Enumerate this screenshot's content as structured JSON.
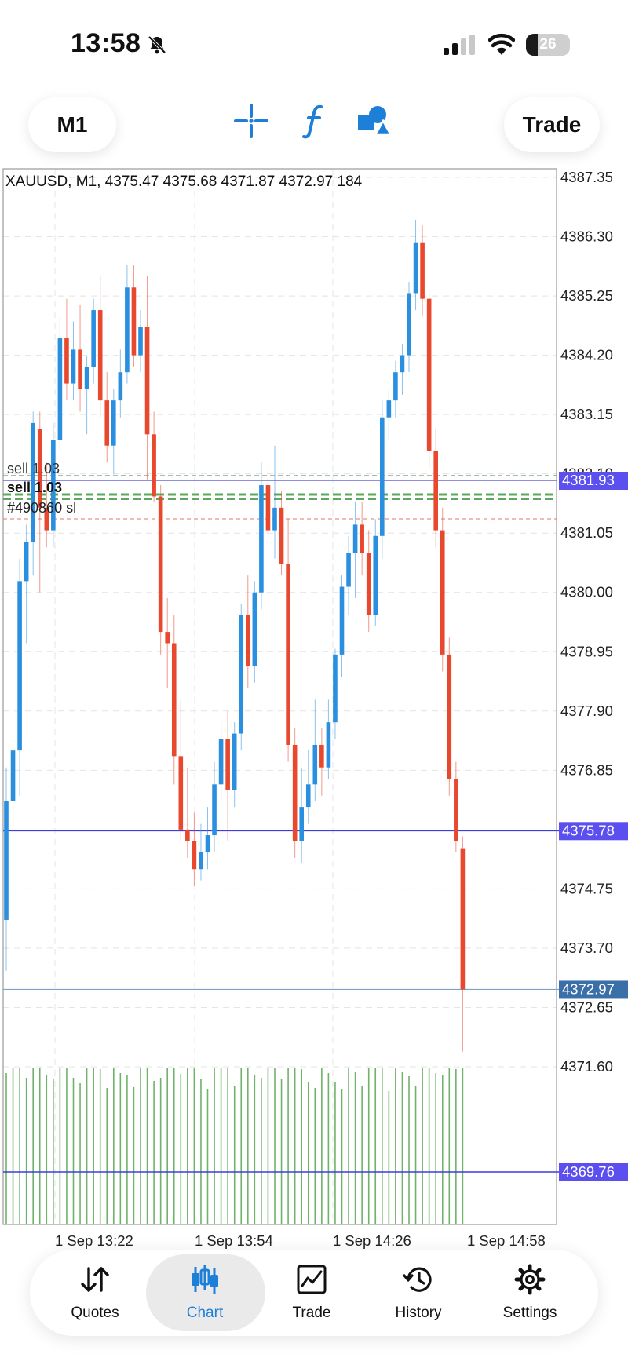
{
  "status_bar": {
    "time": "13:58",
    "battery": "26",
    "battery_level": 0.26
  },
  "toolbar": {
    "timeframe": "M1",
    "trade_label": "Trade",
    "icons": [
      "crosshair-icon",
      "indicators-icon",
      "objects-icon"
    ]
  },
  "chart": {
    "header": "XAUUSD, M1, 4375.47 4375.68 4371.87 4372.97 184",
    "price_scale": [
      "4387.35",
      "4386.30",
      "4385.25",
      "4384.20",
      "4383.15",
      "4382.10",
      "4381.05",
      "4380.00",
      "4378.95",
      "4377.90",
      "4376.85",
      "4374.75",
      "4373.70",
      "4372.65",
      "4371.60"
    ],
    "price_tags": {
      "tag1": "4381.93",
      "tag2": "4375.78",
      "current": "4372.97",
      "volume_line": "4369.76"
    },
    "time_labels": [
      "1 Sep 13:22",
      "1 Sep 13:54",
      "1 Sep 14:26",
      "1 Sep 14:58"
    ],
    "order_labels": {
      "sell_top": "sell 1.03",
      "sell_bold": "sell 1.03",
      "order_id": "#490860 sl"
    },
    "colors": {
      "bull": "#2b8fe0",
      "bear": "#e8482d",
      "volume": "#6fb36a",
      "level_line": "#3d3de0",
      "tag": "#5b4ff0",
      "current_tag": "#3a6fa8",
      "grid": "#e4e4e4"
    }
  },
  "chart_data": {
    "type": "candlestick",
    "symbol": "XAUUSD",
    "timeframe": "M1",
    "last_bar": {
      "open": 4375.47,
      "high": 4375.68,
      "low": 4371.87,
      "close": 4372.97,
      "volume": 184
    },
    "ylim": [
      4371.0,
      4387.6
    ],
    "price_ticks": [
      4387.35,
      4386.3,
      4385.25,
      4384.2,
      4383.15,
      4382.1,
      4381.05,
      4380.0,
      4378.95,
      4377.9,
      4376.85,
      4374.75,
      4373.7,
      4372.65,
      4371.6
    ],
    "horizontal_levels": [
      4381.93,
      4375.78,
      4372.97
    ],
    "candles": [
      {
        "o": 4374.2,
        "h": 4376.9,
        "l": 4373.3,
        "c": 4376.3
      },
      {
        "o": 4376.3,
        "h": 4377.4,
        "l": 4375.9,
        "c": 4377.2
      },
      {
        "o": 4377.2,
        "h": 4380.6,
        "l": 4376.4,
        "c": 4380.2
      },
      {
        "o": 4380.2,
        "h": 4381.2,
        "l": 4379.1,
        "c": 4380.9
      },
      {
        "o": 4380.9,
        "h": 4383.2,
        "l": 4380.3,
        "c": 4383.0
      },
      {
        "o": 4382.9,
        "h": 4383.2,
        "l": 4380.0,
        "c": 4381.5
      },
      {
        "o": 4381.5,
        "h": 4382.3,
        "l": 4380.8,
        "c": 4381.1
      },
      {
        "o": 4381.1,
        "h": 4383.0,
        "l": 4380.8,
        "c": 4382.7
      },
      {
        "o": 4382.7,
        "h": 4384.9,
        "l": 4382.5,
        "c": 4384.5
      },
      {
        "o": 4384.5,
        "h": 4385.2,
        "l": 4383.4,
        "c": 4383.7
      },
      {
        "o": 4383.7,
        "h": 4384.8,
        "l": 4383.4,
        "c": 4384.3
      },
      {
        "o": 4384.3,
        "h": 4385.1,
        "l": 4383.2,
        "c": 4383.6
      },
      {
        "o": 4383.6,
        "h": 4384.2,
        "l": 4382.8,
        "c": 4384.0
      },
      {
        "o": 4384.0,
        "h": 4385.2,
        "l": 4383.7,
        "c": 4385.0
      },
      {
        "o": 4385.0,
        "h": 4385.6,
        "l": 4383.1,
        "c": 4383.4
      },
      {
        "o": 4383.4,
        "h": 4383.9,
        "l": 4382.3,
        "c": 4382.6
      },
      {
        "o": 4382.6,
        "h": 4383.6,
        "l": 4382.1,
        "c": 4383.4
      },
      {
        "o": 4383.4,
        "h": 4384.3,
        "l": 4383.1,
        "c": 4383.9
      },
      {
        "o": 4383.9,
        "h": 4385.8,
        "l": 4383.7,
        "c": 4385.4
      },
      {
        "o": 4385.4,
        "h": 4385.8,
        "l": 4384.0,
        "c": 4384.2
      },
      {
        "o": 4384.2,
        "h": 4385.0,
        "l": 4383.9,
        "c": 4384.7
      },
      {
        "o": 4384.7,
        "h": 4385.6,
        "l": 4382.0,
        "c": 4382.8
      },
      {
        "o": 4382.8,
        "h": 4383.2,
        "l": 4381.6,
        "c": 4381.7
      },
      {
        "o": 4381.7,
        "h": 4381.9,
        "l": 4378.9,
        "c": 4379.3
      },
      {
        "o": 4379.3,
        "h": 4379.9,
        "l": 4378.3,
        "c": 4379.1
      },
      {
        "o": 4379.1,
        "h": 4379.6,
        "l": 4376.6,
        "c": 4377.1
      },
      {
        "o": 4377.1,
        "h": 4378.1,
        "l": 4375.6,
        "c": 4375.8
      },
      {
        "o": 4375.8,
        "h": 4376.9,
        "l": 4375.3,
        "c": 4375.6
      },
      {
        "o": 4375.6,
        "h": 4376.1,
        "l": 4374.8,
        "c": 4375.1
      },
      {
        "o": 4375.1,
        "h": 4375.9,
        "l": 4374.9,
        "c": 4375.4
      },
      {
        "o": 4375.4,
        "h": 4376.2,
        "l": 4375.1,
        "c": 4375.7
      },
      {
        "o": 4375.7,
        "h": 4377.0,
        "l": 4375.4,
        "c": 4376.6
      },
      {
        "o": 4376.6,
        "h": 4377.7,
        "l": 4376.3,
        "c": 4377.4
      },
      {
        "o": 4377.4,
        "h": 4377.9,
        "l": 4375.6,
        "c": 4376.5
      },
      {
        "o": 4376.5,
        "h": 4377.7,
        "l": 4376.2,
        "c": 4377.5
      },
      {
        "o": 4377.5,
        "h": 4379.8,
        "l": 4377.2,
        "c": 4379.6
      },
      {
        "o": 4379.6,
        "h": 4380.3,
        "l": 4378.3,
        "c": 4378.7
      },
      {
        "o": 4378.7,
        "h": 4380.2,
        "l": 4378.4,
        "c": 4380.0
      },
      {
        "o": 4380.0,
        "h": 4382.3,
        "l": 4379.7,
        "c": 4381.9
      },
      {
        "o": 4381.9,
        "h": 4382.2,
        "l": 4380.9,
        "c": 4381.1
      },
      {
        "o": 4381.1,
        "h": 4382.6,
        "l": 4380.6,
        "c": 4381.5
      },
      {
        "o": 4381.5,
        "h": 4381.8,
        "l": 4380.3,
        "c": 4380.5
      },
      {
        "o": 4380.5,
        "h": 4381.3,
        "l": 4377.0,
        "c": 4377.3
      },
      {
        "o": 4377.3,
        "h": 4377.6,
        "l": 4375.3,
        "c": 4375.6
      },
      {
        "o": 4375.6,
        "h": 4376.9,
        "l": 4375.2,
        "c": 4376.2
      },
      {
        "o": 4376.2,
        "h": 4377.2,
        "l": 4375.9,
        "c": 4376.6
      },
      {
        "o": 4376.6,
        "h": 4378.1,
        "l": 4376.3,
        "c": 4377.3
      },
      {
        "o": 4377.3,
        "h": 4377.6,
        "l": 4376.4,
        "c": 4376.9
      },
      {
        "o": 4376.9,
        "h": 4378.1,
        "l": 4376.7,
        "c": 4377.7
      },
      {
        "o": 4377.7,
        "h": 4379.0,
        "l": 4377.4,
        "c": 4378.9
      },
      {
        "o": 4378.9,
        "h": 4380.3,
        "l": 4378.5,
        "c": 4380.1
      },
      {
        "o": 4380.1,
        "h": 4381.0,
        "l": 4379.6,
        "c": 4380.7
      },
      {
        "o": 4380.7,
        "h": 4381.6,
        "l": 4379.9,
        "c": 4381.2
      },
      {
        "o": 4381.2,
        "h": 4381.6,
        "l": 4380.3,
        "c": 4380.7
      },
      {
        "o": 4380.7,
        "h": 4381.1,
        "l": 4379.3,
        "c": 4379.6
      },
      {
        "o": 4379.6,
        "h": 4381.3,
        "l": 4379.4,
        "c": 4381.0
      },
      {
        "o": 4381.0,
        "h": 4383.4,
        "l": 4380.6,
        "c": 4383.1
      },
      {
        "o": 4383.1,
        "h": 4383.6,
        "l": 4382.7,
        "c": 4383.4
      },
      {
        "o": 4383.4,
        "h": 4384.1,
        "l": 4383.1,
        "c": 4383.9
      },
      {
        "o": 4383.9,
        "h": 4384.4,
        "l": 4383.5,
        "c": 4384.2
      },
      {
        "o": 4384.2,
        "h": 4385.5,
        "l": 4383.9,
        "c": 4385.3
      },
      {
        "o": 4385.3,
        "h": 4386.6,
        "l": 4385.0,
        "c": 4386.2
      },
      {
        "o": 4386.2,
        "h": 4386.5,
        "l": 4384.9,
        "c": 4385.2
      },
      {
        "o": 4385.2,
        "h": 4385.3,
        "l": 4382.2,
        "c": 4382.5
      },
      {
        "o": 4382.5,
        "h": 4382.9,
        "l": 4380.8,
        "c": 4381.1
      },
      {
        "o": 4381.1,
        "h": 4381.5,
        "l": 4378.6,
        "c": 4378.9
      },
      {
        "o": 4378.9,
        "h": 4379.2,
        "l": 4376.4,
        "c": 4376.7
      },
      {
        "o": 4376.7,
        "h": 4377.0,
        "l": 4375.4,
        "c": 4375.6
      },
      {
        "o": 4375.47,
        "h": 4375.68,
        "l": 4371.87,
        "c": 4372.97
      }
    ]
  },
  "nav": {
    "items": [
      {
        "label": "Quotes",
        "icon": "quotes-icon"
      },
      {
        "label": "Chart",
        "icon": "chart-icon"
      },
      {
        "label": "Trade",
        "icon": "trade-icon"
      },
      {
        "label": "History",
        "icon": "history-icon"
      },
      {
        "label": "Settings",
        "icon": "settings-icon"
      }
    ],
    "active": "Chart"
  }
}
